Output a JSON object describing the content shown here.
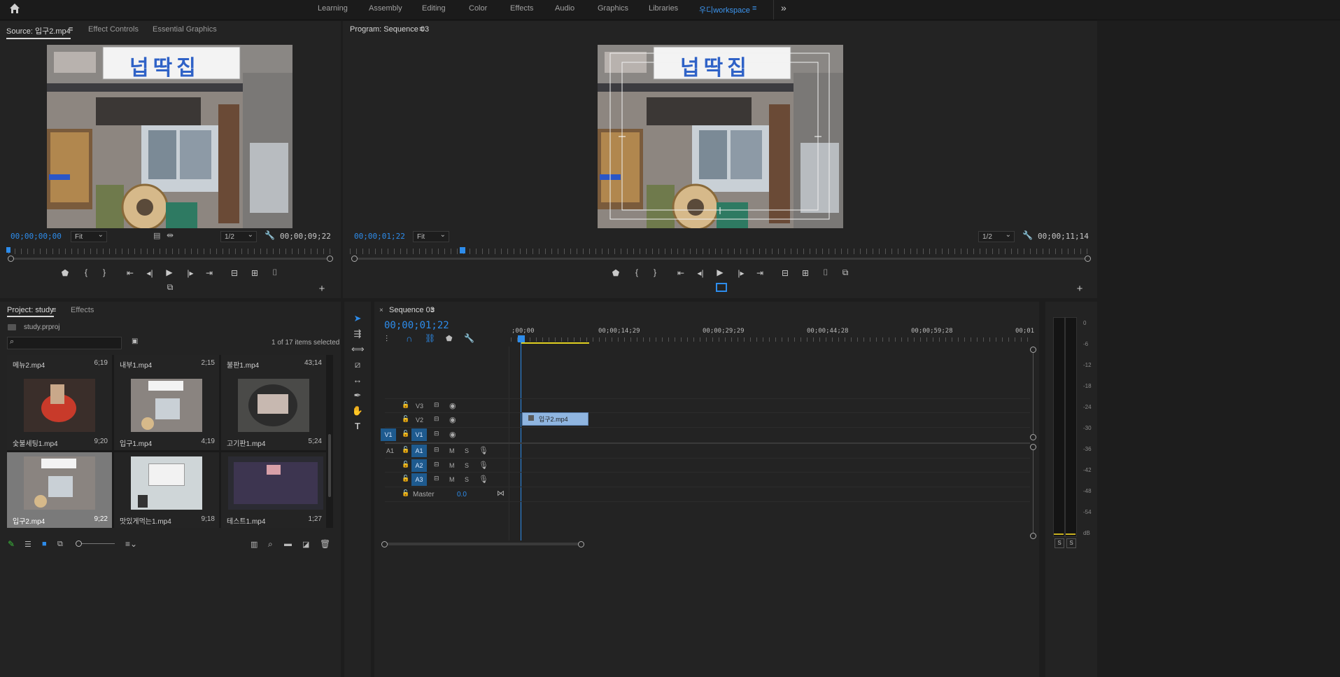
{
  "workspaces": {
    "items": [
      "Learning",
      "Assembly",
      "Editing",
      "Color",
      "Effects",
      "Audio",
      "Graphics",
      "Libraries"
    ],
    "active": "우디workspace",
    "more": "»"
  },
  "source_monitor": {
    "tabs": [
      "Source: 입구2.mp4",
      "Effect Controls",
      "Essential Graphics"
    ],
    "timecode_in": "00;00;00;00",
    "zoom": "Fit",
    "resolution": "1/2",
    "duration": "00;00;09;22"
  },
  "program_monitor": {
    "title": "Program: Sequence 03",
    "timecode": "00;00;01;22",
    "zoom": "Fit",
    "resolution": "1/2",
    "duration": "00;00;11;14"
  },
  "sign_text": "넙딱집",
  "project": {
    "tabs": [
      "Project: study",
      "Effects"
    ],
    "file": "study.prproj",
    "selection_info": "1 of 17 items selected",
    "rows": [
      [
        {
          "name": "메뉴2.mp4",
          "dur": "6;19",
          "top": true
        },
        {
          "name": "내부1.mp4",
          "dur": "2;15",
          "top": true
        },
        {
          "name": "불판1.mp4",
          "dur": "43;14",
          "top": true
        }
      ],
      [
        {
          "name": "숯불세팅1.mp4",
          "dur": "9;20"
        },
        {
          "name": "입구1.mp4",
          "dur": "4;19"
        },
        {
          "name": "고기판1.mp4",
          "dur": "5;24"
        }
      ],
      [
        {
          "name": "입구2.mp4",
          "dur": "9;22"
        },
        {
          "name": "맛있게먹는1.mp4",
          "dur": "9;18"
        },
        {
          "name": "테스트1.mp4",
          "dur": "1;27"
        }
      ]
    ]
  },
  "timeline": {
    "tab": "Sequence 03",
    "timecode": "00;00;01;22",
    "ruler_labels": [
      ";00;00",
      "00;00;14;29",
      "00;00;29;29",
      "00;00;44;28",
      "00;00;59;28",
      "00;01"
    ],
    "video_tracks": [
      "V3",
      "V2",
      "V1"
    ],
    "source_patch": "V1",
    "audio_tracks": [
      "A1",
      "A2",
      "A3"
    ],
    "audio_source_patch": "A1",
    "master_label": "Master",
    "master_value": "0.0",
    "clip_name": "입구2.mp4"
  },
  "meter": {
    "labels": [
      "0",
      "-6",
      "-12",
      "-18",
      "-24",
      "-30",
      "-36",
      "-42",
      "-48",
      "-54",
      "dB"
    ],
    "solo": [
      "S",
      "S"
    ]
  }
}
